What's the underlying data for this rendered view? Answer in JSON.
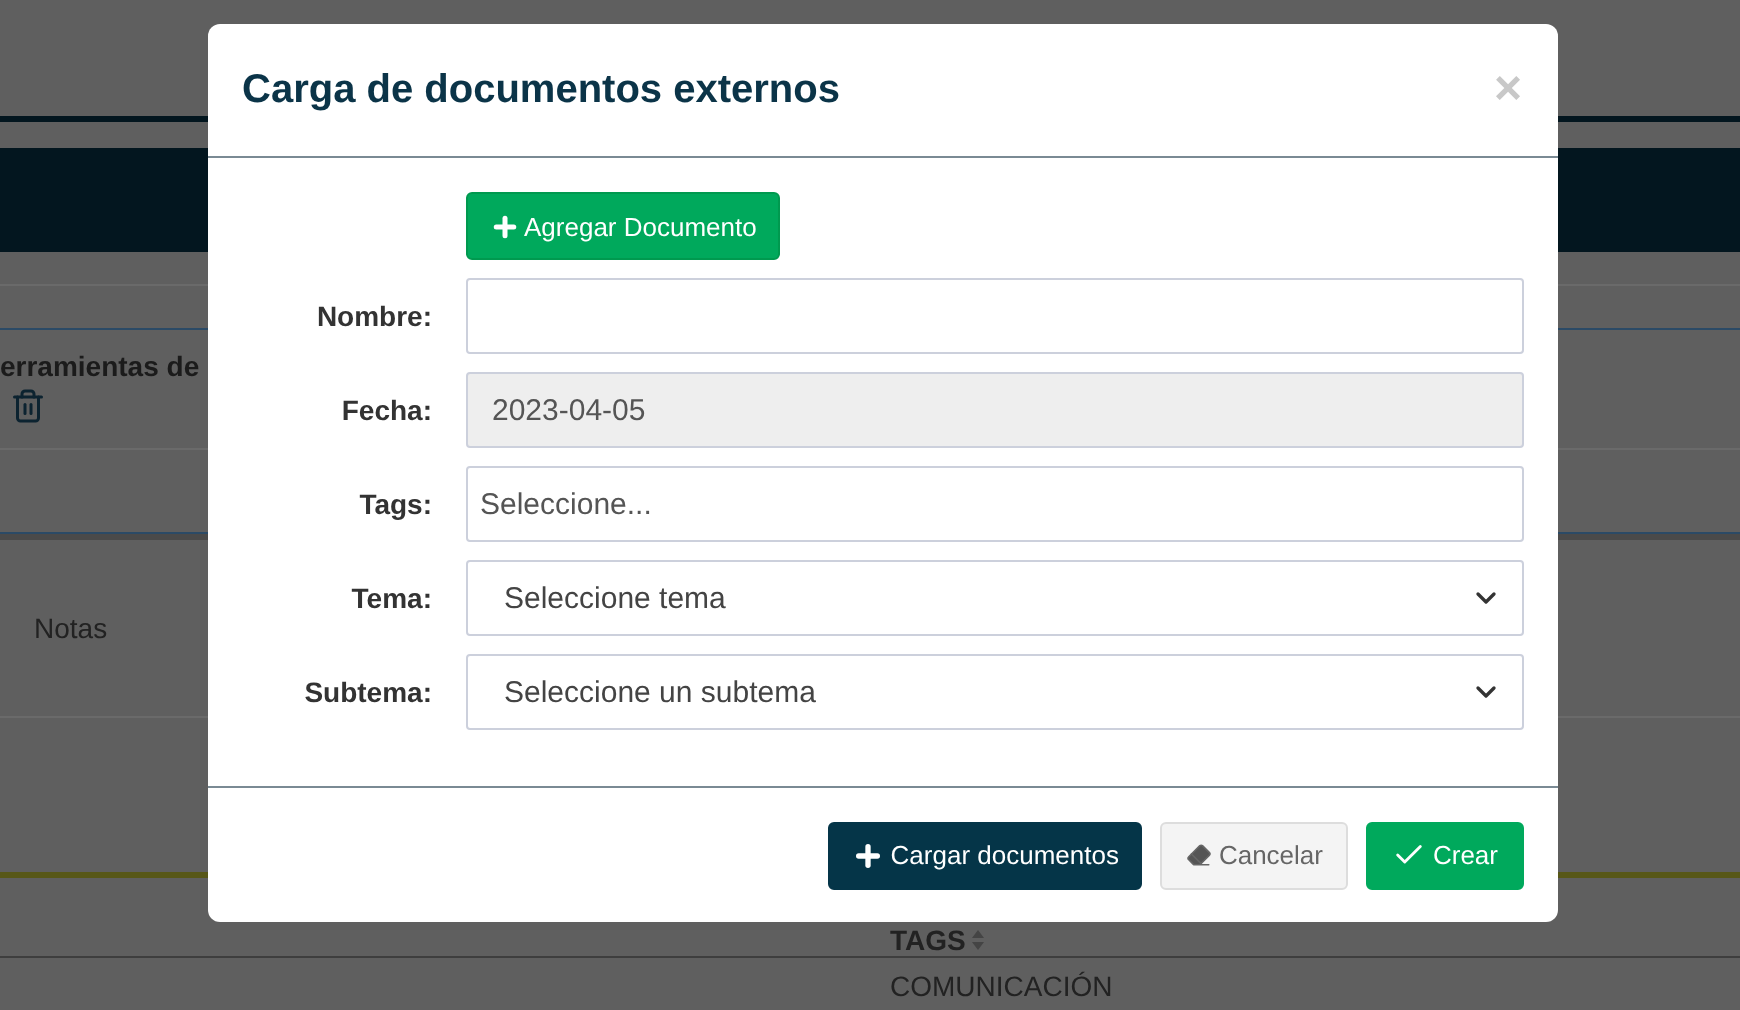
{
  "background": {
    "section_title": "erramientas de",
    "table_header": "Notas",
    "column_header": "TAGS",
    "row_cell": "COMUNICACIÓN"
  },
  "modal": {
    "title": "Carga de documentos externos",
    "close": "×",
    "add_button": "Agregar Documento",
    "fields": [
      {
        "kind": "text",
        "label": "Nombre:",
        "disabled": false
      },
      {
        "kind": "date",
        "label": "Fecha:",
        "value": "2023-04-05",
        "disabled": true
      },
      {
        "kind": "tags",
        "label": "Tags:",
        "placeholder": "Seleccione...",
        "disabled": false
      },
      {
        "kind": "select",
        "label": "Tema:",
        "value": "Seleccione tema",
        "disabled": false
      },
      {
        "kind": "select",
        "label": "Subtema:",
        "value": "Seleccione un subtema",
        "disabled": false
      }
    ],
    "buttons": [
      {
        "kind": "primary",
        "label": "Cargar documentos"
      },
      {
        "kind": "cancel",
        "label": "Cancelar"
      },
      {
        "kind": "create",
        "label": "Crear"
      }
    ]
  }
}
